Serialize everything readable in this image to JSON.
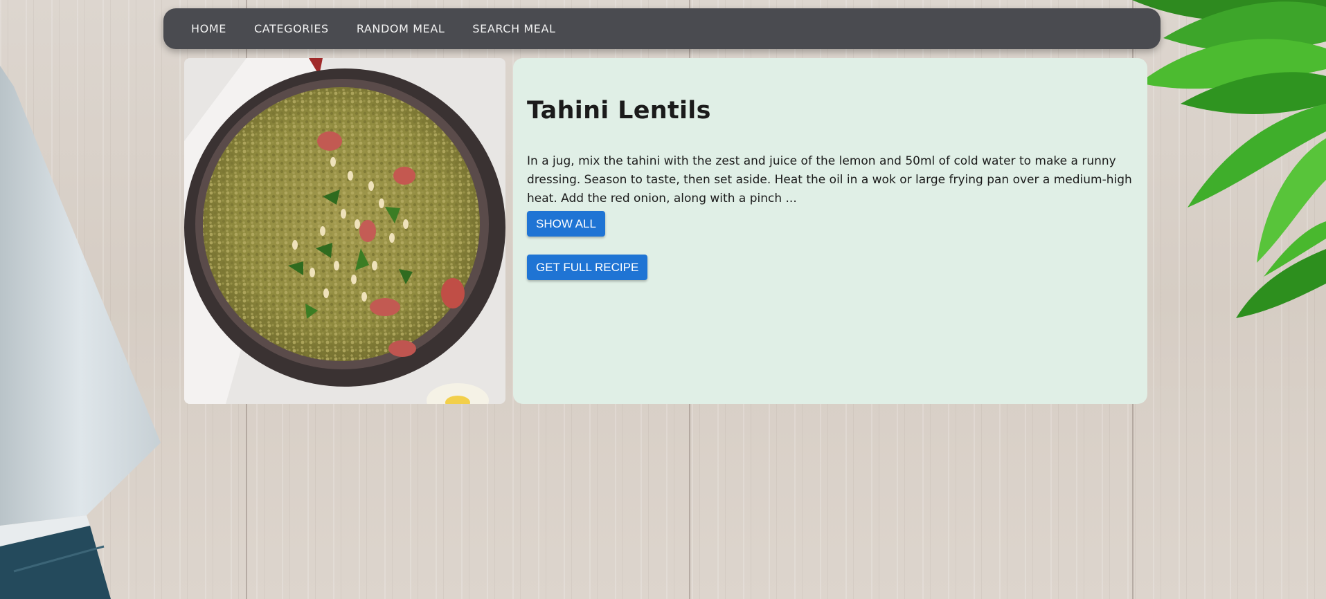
{
  "nav": {
    "items": [
      {
        "label": "HOME"
      },
      {
        "label": "CATEGORIES"
      },
      {
        "label": "RANDOM MEAL"
      },
      {
        "label": "SEARCH MEAL"
      }
    ]
  },
  "meal": {
    "title": "Tahini Lentils",
    "description": "In a jug, mix the tahini with the zest and juice of the lemon and 50ml of cold water to make a runny dressing. Season to taste, then set aside. Heat the oil in a wok or large frying pan over a medium-high heat. Add the red onion, along with a pinch ...",
    "show_all_label": "SHOW ALL",
    "full_recipe_label": "GET FULL RECIPE"
  },
  "colors": {
    "nav_bg": "#4a4b50",
    "card_bg": "#e0efe6",
    "button": "#1f74d4"
  }
}
